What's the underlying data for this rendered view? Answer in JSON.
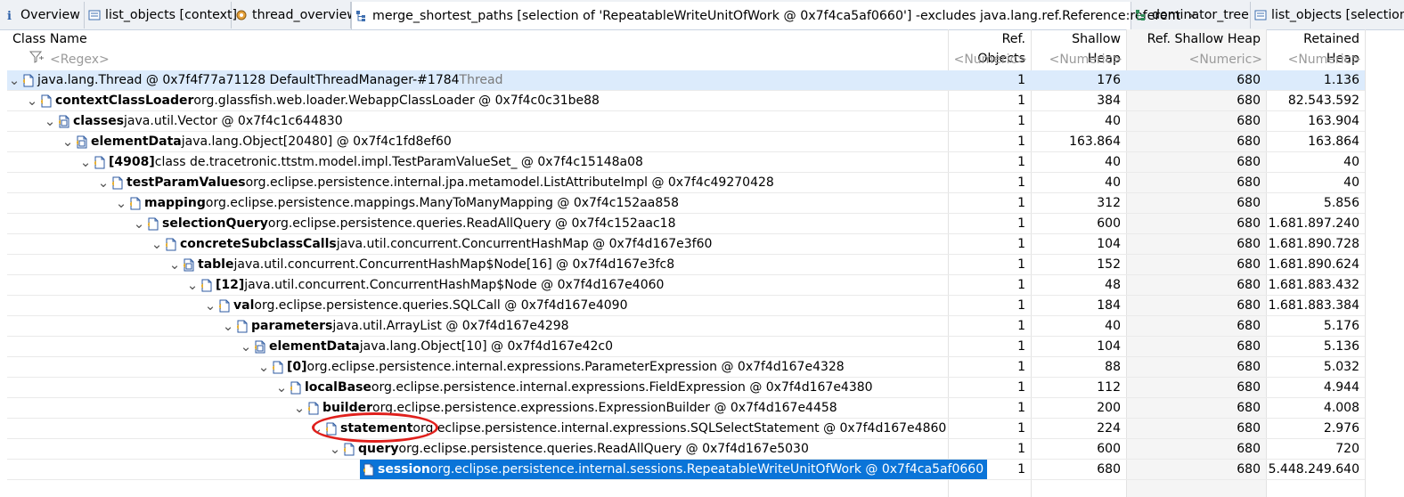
{
  "tabs": [
    {
      "label": "Overview",
      "icon": "info-icon"
    },
    {
      "label": "list_objects [context]",
      "icon": "list-icon"
    },
    {
      "label": "thread_overview",
      "icon": "gear-icon"
    },
    {
      "label": "merge_shortest_paths [selection of 'RepeatableWriteUnitOfWork @ 0x7f4ca5af0660'] -excludes java.lang.ref.Reference:referent",
      "icon": "tree-icon"
    },
    {
      "label": "dominator_tree",
      "icon": "tree-icon"
    },
    {
      "label": "list_objects [selection",
      "icon": "list-icon"
    }
  ],
  "columns": {
    "class_name": "Class Name",
    "ref_objects": "Ref. Objects",
    "shallow_heap": "Shallow Heap",
    "ref_shallow_heap": "Ref. Shallow Heap",
    "retained_heap": "Retained Heap"
  },
  "filters": {
    "class_name": "<Regex>",
    "ref_objects": "<Numeric>",
    "shallow_heap": "<Numeric>",
    "ref_shallow_heap": "<Numeric>",
    "retained_heap": "<Numeric>"
  },
  "rows": [
    {
      "field": "",
      "cls": "java.lang.Thread @ 0x7f4f77a71128  DefaultThreadManager-#1784",
      "suffix": "Thread",
      "ref": "1",
      "shallow": "176",
      "refShallow": "680",
      "retained": "1.136"
    },
    {
      "field": "contextClassLoader",
      "cls": "org.glassfish.web.loader.WebappClassLoader @ 0x7f4c0c31be88",
      "suffix": "",
      "ref": "1",
      "shallow": "384",
      "refShallow": "680",
      "retained": "82.543.592"
    },
    {
      "field": "classes",
      "cls": "java.util.Vector @ 0x7f4c1c644830",
      "suffix": "",
      "ref": "1",
      "shallow": "40",
      "refShallow": "680",
      "retained": "163.904"
    },
    {
      "field": "elementData",
      "cls": "java.lang.Object[20480] @ 0x7f4c1fd8ef60",
      "suffix": "",
      "ref": "1",
      "shallow": "163.864",
      "refShallow": "680",
      "retained": "163.864"
    },
    {
      "field": "[4908]",
      "cls": "class de.tracetronic.ttstm.model.impl.TestParamValueSet_ @ 0x7f4c15148a08",
      "suffix": "",
      "ref": "1",
      "shallow": "40",
      "refShallow": "680",
      "retained": "40"
    },
    {
      "field": "testParamValues",
      "cls": "org.eclipse.persistence.internal.jpa.metamodel.ListAttributeImpl @ 0x7f4c49270428",
      "suffix": "",
      "ref": "1",
      "shallow": "40",
      "refShallow": "680",
      "retained": "40"
    },
    {
      "field": "mapping",
      "cls": "org.eclipse.persistence.mappings.ManyToManyMapping @ 0x7f4c152aa858",
      "suffix": "",
      "ref": "1",
      "shallow": "312",
      "refShallow": "680",
      "retained": "5.856"
    },
    {
      "field": "selectionQuery",
      "cls": "org.eclipse.persistence.queries.ReadAllQuery @ 0x7f4c152aac18",
      "suffix": "",
      "ref": "1",
      "shallow": "600",
      "refShallow": "680",
      "retained": "1.681.897.240"
    },
    {
      "field": "concreteSubclassCalls",
      "cls": "java.util.concurrent.ConcurrentHashMap @ 0x7f4d167e3f60",
      "suffix": "",
      "ref": "1",
      "shallow": "104",
      "refShallow": "680",
      "retained": "1.681.890.728"
    },
    {
      "field": "table",
      "cls": "java.util.concurrent.ConcurrentHashMap$Node[16] @ 0x7f4d167e3fc8",
      "suffix": "",
      "ref": "1",
      "shallow": "152",
      "refShallow": "680",
      "retained": "1.681.890.624"
    },
    {
      "field": "[12]",
      "cls": "java.util.concurrent.ConcurrentHashMap$Node @ 0x7f4d167e4060",
      "suffix": "",
      "ref": "1",
      "shallow": "48",
      "refShallow": "680",
      "retained": "1.681.883.432"
    },
    {
      "field": "val",
      "cls": "org.eclipse.persistence.queries.SQLCall @ 0x7f4d167e4090",
      "suffix": "",
      "ref": "1",
      "shallow": "184",
      "refShallow": "680",
      "retained": "1.681.883.384"
    },
    {
      "field": "parameters",
      "cls": "java.util.ArrayList @ 0x7f4d167e4298",
      "suffix": "",
      "ref": "1",
      "shallow": "40",
      "refShallow": "680",
      "retained": "5.176"
    },
    {
      "field": "elementData",
      "cls": "java.lang.Object[10] @ 0x7f4d167e42c0",
      "suffix": "",
      "ref": "1",
      "shallow": "104",
      "refShallow": "680",
      "retained": "5.136"
    },
    {
      "field": "[0]",
      "cls": "org.eclipse.persistence.internal.expressions.ParameterExpression @ 0x7f4d167e4328",
      "suffix": "",
      "ref": "1",
      "shallow": "88",
      "refShallow": "680",
      "retained": "5.032"
    },
    {
      "field": "localBase",
      "cls": "org.eclipse.persistence.internal.expressions.FieldExpression @ 0x7f4d167e4380",
      "suffix": "",
      "ref": "1",
      "shallow": "112",
      "refShallow": "680",
      "retained": "4.944"
    },
    {
      "field": "builder",
      "cls": "org.eclipse.persistence.expressions.ExpressionBuilder @ 0x7f4d167e4458",
      "suffix": "",
      "ref": "1",
      "shallow": "200",
      "refShallow": "680",
      "retained": "4.008"
    },
    {
      "field": "statement",
      "cls": "org.eclipse.persistence.internal.expressions.SQLSelectStatement @ 0x7f4d167e4860",
      "suffix": "",
      "ref": "1",
      "shallow": "224",
      "refShallow": "680",
      "retained": "2.976"
    },
    {
      "field": "query",
      "cls": "org.eclipse.persistence.queries.ReadAllQuery @ 0x7f4d167e5030",
      "suffix": "",
      "ref": "1",
      "shallow": "600",
      "refShallow": "680",
      "retained": "720"
    },
    {
      "field": "session",
      "cls": "org.eclipse.persistence.internal.sessions.RepeatableWriteUnitOfWork @ 0x7f4ca5af0660",
      "suffix": "",
      "ref": "1",
      "shallow": "680",
      "refShallow": "680",
      "retained": "5.448.249.640"
    }
  ],
  "colors": {
    "selection": "#0a74d8",
    "root_row": "#dcebfc",
    "highlight_ring": "#e0201c",
    "thread_suffix": "#7a7a7a"
  }
}
